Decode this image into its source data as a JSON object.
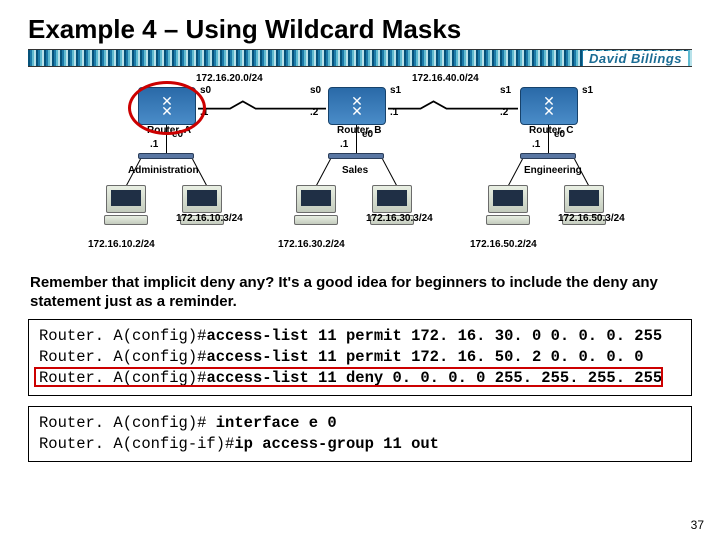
{
  "title": "Example 4 – Using Wildcard Masks",
  "author": "David Billings",
  "page_number": "37",
  "diagram": {
    "nets": {
      "wan_ab": "172.16.20.0/24",
      "wan_bc": "172.16.40.0/24"
    },
    "routerA": "Router. A",
    "routerB": "Router. B",
    "routerC": "Router. C",
    "ifs": {
      "a_s0": "s0",
      "ab_s0": "s0",
      "b_s1": "s1",
      "bc_s1": "s1",
      "c_s1": "s1",
      "a_s0_ip": ".1",
      "ab_s0_ip": ".2",
      "b_s1_ip": ".1",
      "bc_s1_ip": ".2",
      "a_e0": "e0",
      "b_e0": "e0",
      "c_e0": "e0",
      "a_e0_ip": ".1",
      "b_e0_ip": ".1",
      "c_e0_ip": ".1"
    },
    "segments": {
      "admin": "Administration",
      "sales": "Sales",
      "eng": "Engineering"
    },
    "hosts": {
      "a1": "172.16.10.2/24",
      "a2": "172.16.10.3/24",
      "s1": "172.16.30.2/24",
      "s2": "172.16.30.3/24",
      "e1": "172.16.50.2/24",
      "e2": "172.16.50.3/24"
    }
  },
  "remember": "Remember that implicit deny any? It's a good idea for beginners to include the deny any statement just as a reminder.",
  "code1": {
    "l1_prompt": "Router. A(config)#",
    "l1_cmd": "access-list 11 permit 172. 16. 30. 0 0. 0. 0. 255",
    "l2_prompt": "Router. A(config)#",
    "l2_cmd": "access-list 11 permit 172. 16. 50. 2 0. 0. 0. 0",
    "l3_prompt": "Router. A(config)#",
    "l3_cmd": "access-list 11 deny 0. 0. 0. 0 255. 255. 255. 255"
  },
  "code2": {
    "l1_prompt": "Router. A(config)# ",
    "l1_cmd": "interface e 0",
    "l2_prompt": "Router. A(config-if)#",
    "l2_cmd": "ip access-group 11 out"
  }
}
